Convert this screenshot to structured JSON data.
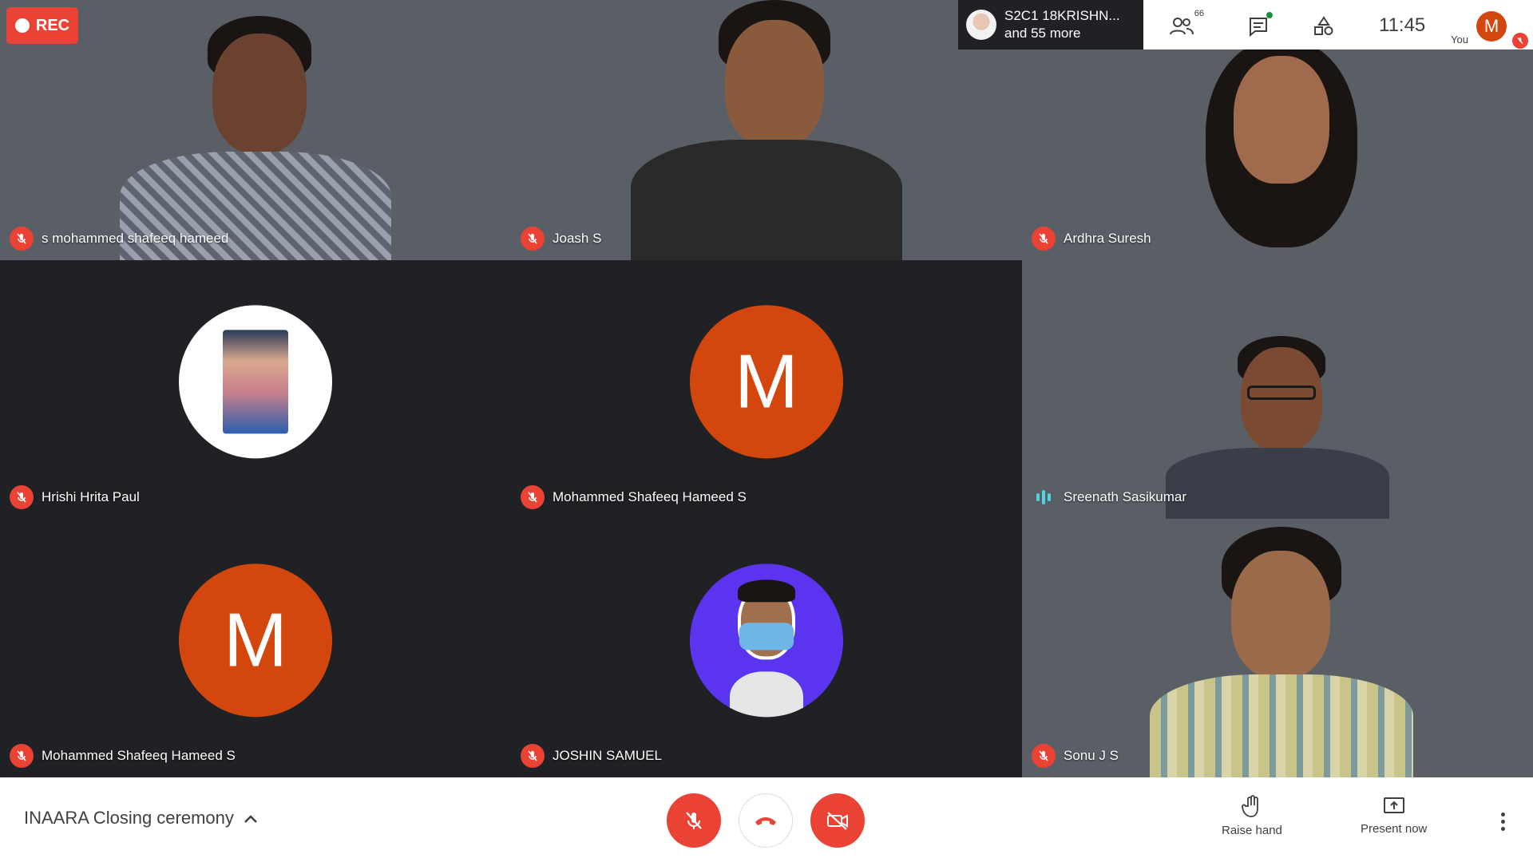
{
  "recording": {
    "label": "REC"
  },
  "presenter_chip": {
    "line1": "S2C1 18KRISHN...",
    "line2": "and 55 more"
  },
  "top_bar": {
    "participants_count": "66",
    "clock": "11:45",
    "you_label": "You",
    "you_initial": "M",
    "icons": [
      "people-icon",
      "chat-icon",
      "activities-icon"
    ]
  },
  "tiles": [
    {
      "name": "s mohammed shafeeq hameed",
      "muted": true,
      "kind": "video"
    },
    {
      "name": "Joash S",
      "muted": true,
      "kind": "video"
    },
    {
      "name": "Ardhra Suresh",
      "muted": true,
      "kind": "video"
    },
    {
      "name": "Hrishi Hrita Paul",
      "muted": true,
      "kind": "photo-avatar"
    },
    {
      "name": "Mohammed Shafeeq Hameed S",
      "muted": true,
      "kind": "letter-avatar",
      "initial": "M"
    },
    {
      "name": "Sreenath Sasikumar",
      "muted": false,
      "speaking": true,
      "kind": "video"
    },
    {
      "name": "Mohammed Shafeeq Hameed S",
      "muted": true,
      "kind": "letter-avatar",
      "initial": "M"
    },
    {
      "name": "JOSHIN SAMUEL",
      "muted": true,
      "kind": "photo-avatar"
    },
    {
      "name": "Sonu J S",
      "muted": true,
      "kind": "video"
    }
  ],
  "bottom_bar": {
    "meeting_title": "INAARA Closing ceremony",
    "raise_hand": "Raise hand",
    "present_now": "Present now"
  },
  "colors": {
    "accent_red": "#ea4335",
    "avatar_orange": "#d3470e",
    "avatar_purple": "#5b34f0",
    "background": "#202124"
  }
}
